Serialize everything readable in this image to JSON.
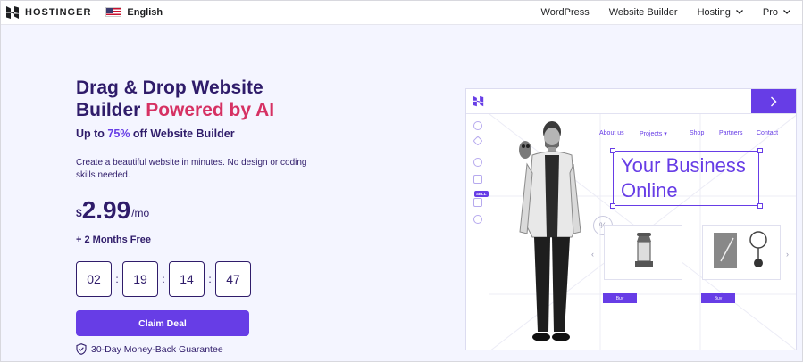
{
  "brand": {
    "name": "HOSTINGER",
    "icon": "hostinger-logo-icon"
  },
  "language": {
    "label": "English",
    "icon": "us-flag-icon"
  },
  "nav": {
    "links": [
      "WordPress",
      "Website Builder",
      "Hosting",
      "Pro"
    ]
  },
  "hero": {
    "title_line1": "Drag & Drop Website",
    "title_line2_plain": "Builder ",
    "title_line2_accent": "Powered by AI",
    "subtitle_prefix": "Up to ",
    "subtitle_pct": "75%",
    "subtitle_suffix": " off Website Builder",
    "description": "Create a beautiful website in minutes. No design or coding skills needed.",
    "price_currency": "$",
    "price_amount": "2.99",
    "price_period": "/mo",
    "bonus": "+ 2 Months Free",
    "timer": [
      "02",
      "19",
      "14",
      "47"
    ],
    "timer_separator": ":",
    "cta_label": "Claim Deal",
    "guarantee": "30-Day Money-Back Guarantee"
  },
  "mockup": {
    "menu": [
      "About us",
      "Projects ▾",
      "Shop",
      "Partners",
      "Contact"
    ],
    "headline_line1": "Your Business",
    "headline_line2": "Online",
    "badge": "SELL",
    "percent": "%",
    "buy_label": "Buy",
    "arrow_left": "‹",
    "arrow_right": "›"
  },
  "colors": {
    "accent": "#673de6",
    "pink": "#d63163",
    "navy": "#2f1c6a",
    "background": "#f4f5ff"
  }
}
